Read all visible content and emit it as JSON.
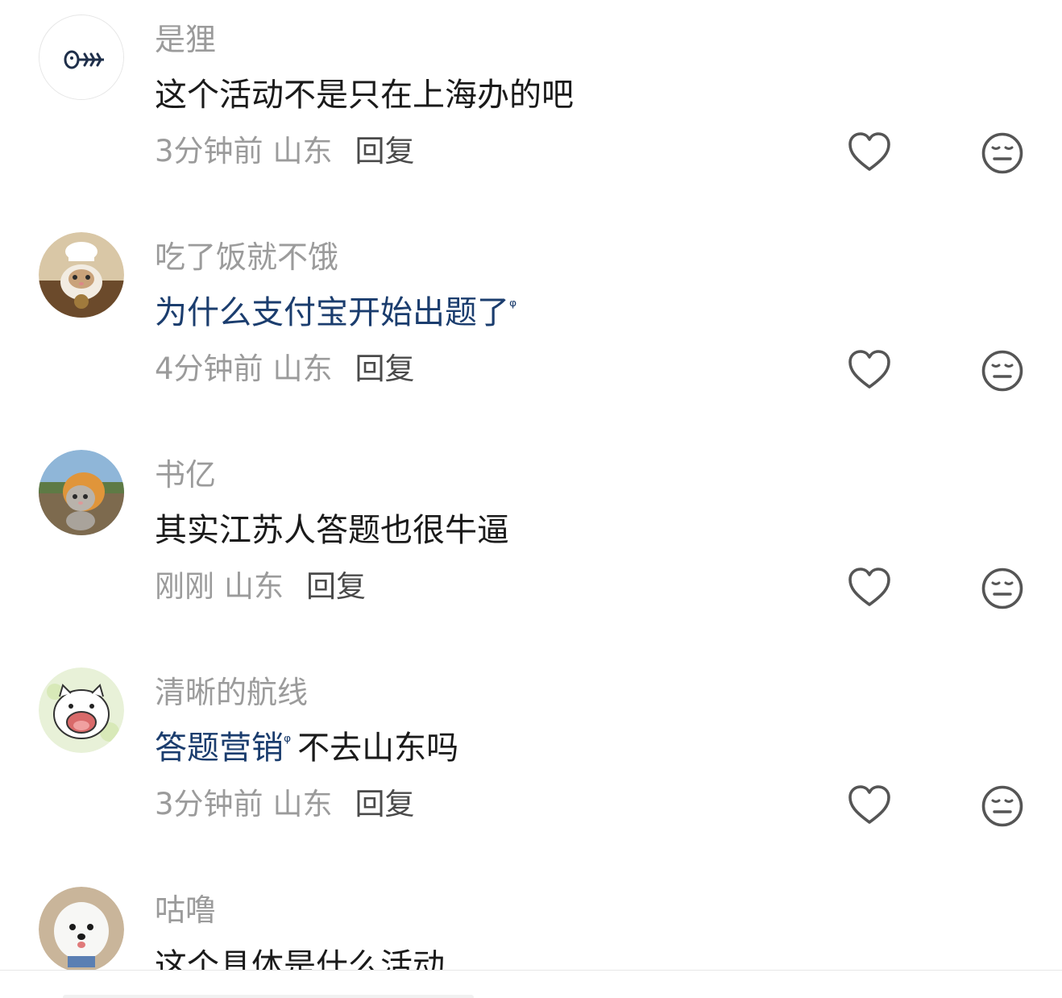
{
  "comments": [
    {
      "username": "是狸",
      "content_parts": [
        {
          "text": "这个活动不是只在上海办的吧",
          "topic": false
        }
      ],
      "time": "3分钟前",
      "location": "山东",
      "reply_label": "回复",
      "avatar": "fishbone-avatar"
    },
    {
      "username": "吃了饭就不饿",
      "content_parts": [
        {
          "text": "为什么支付宝开始出题了",
          "topic": true
        }
      ],
      "time": "4分钟前",
      "location": "山东",
      "reply_label": "回复",
      "avatar": "chef-cat-avatar"
    },
    {
      "username": "书亿",
      "content_parts": [
        {
          "text": "其实江苏人答题也很牛逼",
          "topic": false
        }
      ],
      "time": "刚刚",
      "location": "山东",
      "reply_label": "回复",
      "avatar": "lion-cat-avatar"
    },
    {
      "username": "清晰的航线",
      "content_parts": [
        {
          "text": "答题营销",
          "topic": true
        },
        {
          "text": "不去山东吗",
          "topic": false
        }
      ],
      "time": "3分钟前",
      "location": "山东",
      "reply_label": "回复",
      "avatar": "shouting-cat-avatar"
    },
    {
      "username": "咕噜",
      "content_parts": [
        {
          "text": "这个具体是什么活动",
          "topic": false
        }
      ],
      "time": "",
      "location": "",
      "reply_label": "",
      "avatar": "white-dog-avatar"
    }
  ],
  "colors": {
    "username": "#9b9b9b",
    "content": "#1a1a1a",
    "topic_link": "#1b3d6e",
    "icon": "#555555"
  },
  "icons": {
    "like": "heart-outline-icon",
    "dislike": "neutral-face-icon",
    "topic_marker": "search-icon"
  }
}
